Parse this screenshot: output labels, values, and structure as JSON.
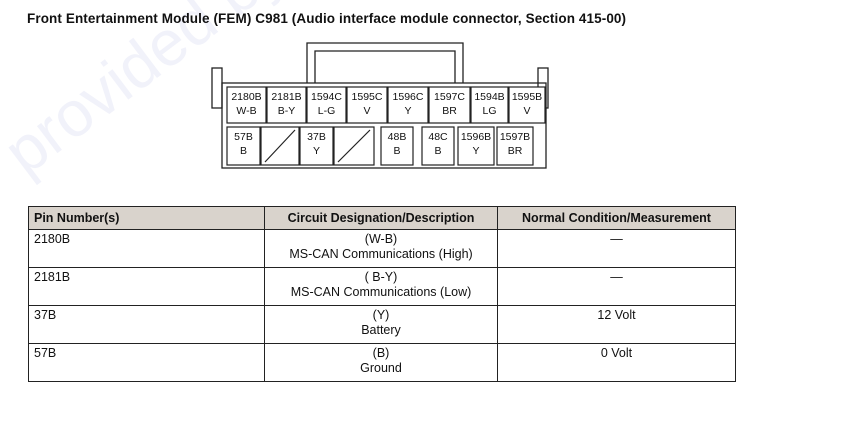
{
  "title": "Front Entertainment Module (FEM) C981 (Audio interface module connector, Section 415-00)",
  "connector": {
    "top_row": [
      {
        "pin": "2180B",
        "color": "W-B"
      },
      {
        "pin": "2181B",
        "color": "B-Y"
      },
      {
        "pin": "1594C",
        "color": "L-G"
      },
      {
        "pin": "1595C",
        "color": "V"
      },
      {
        "pin": "1596C",
        "color": "Y"
      },
      {
        "pin": "1597C",
        "color": "BR"
      },
      {
        "pin": "1594B",
        "color": "LG"
      },
      {
        "pin": "1595B",
        "color": "V"
      }
    ],
    "bottom_row": [
      {
        "pin": "57B",
        "color": "B"
      },
      {
        "pin": "37B",
        "color": "Y"
      },
      {
        "pin": "48B",
        "color": "B"
      },
      {
        "pin": "48C",
        "color": "B"
      },
      {
        "pin": "1596B",
        "color": "Y"
      },
      {
        "pin": "1597B",
        "color": "BR"
      }
    ]
  },
  "table": {
    "headers": [
      "Pin Number(s)",
      "Circuit Designation/Description",
      "Normal Condition/Measurement"
    ],
    "rows": [
      {
        "pin": "2180B",
        "circuit": "(W-B)",
        "description": "MS-CAN Communications (High)",
        "measurement": "—"
      },
      {
        "pin": "2181B",
        "circuit": "( B-Y)",
        "description": "MS-CAN Communications (Low)",
        "measurement": "—"
      },
      {
        "pin": "37B",
        "circuit": "(Y)",
        "description": "Battery",
        "measurement": "12 Volt"
      },
      {
        "pin": "57B",
        "circuit": "(B)",
        "description": "Ground",
        "measurement": "0 Volt"
      }
    ]
  },
  "watermark": "provided by"
}
